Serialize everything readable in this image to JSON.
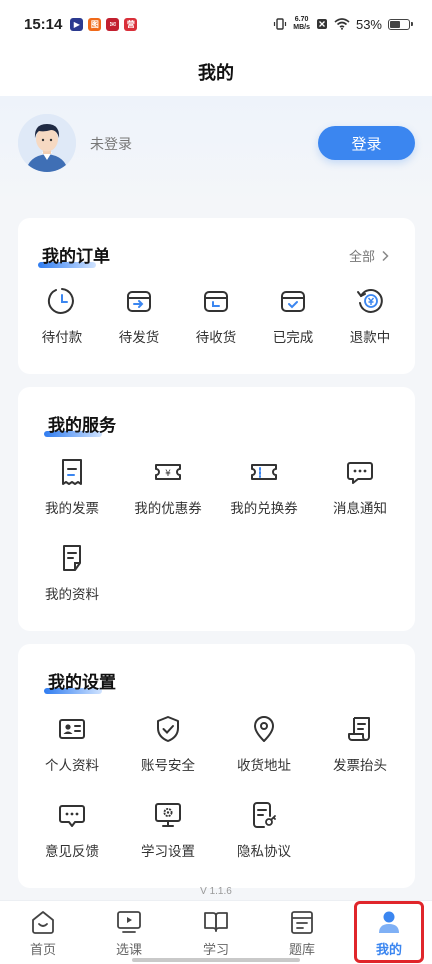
{
  "status": {
    "time": "15:14",
    "net_speed_value": "6.70",
    "net_speed_unit": "MB/s",
    "battery": "53%",
    "battery_level": 0.53
  },
  "page": {
    "title": "我的"
  },
  "profile": {
    "hint": "未登录",
    "login_label": "登录"
  },
  "orders": {
    "title": "我的订单",
    "more_label": "全部",
    "items": [
      {
        "label": "待付款",
        "icon": "clock-icon"
      },
      {
        "label": "待发货",
        "icon": "box-arrow-icon"
      },
      {
        "label": "待收货",
        "icon": "box-receive-icon"
      },
      {
        "label": "已完成",
        "icon": "box-check-icon"
      },
      {
        "label": "退款中",
        "icon": "refund-icon"
      }
    ]
  },
  "services": {
    "title": "我的服务",
    "items": [
      {
        "label": "我的发票",
        "icon": "invoice-icon"
      },
      {
        "label": "我的优惠券",
        "icon": "coupon-icon"
      },
      {
        "label": "我的兑换券",
        "icon": "voucher-icon"
      },
      {
        "label": "消息通知",
        "icon": "message-icon"
      },
      {
        "label": "我的资料",
        "icon": "document-icon"
      }
    ]
  },
  "settings": {
    "title": "我的设置",
    "items": [
      {
        "label": "个人资料",
        "icon": "id-card-icon"
      },
      {
        "label": "账号安全",
        "icon": "shield-icon"
      },
      {
        "label": "收货地址",
        "icon": "location-icon"
      },
      {
        "label": "发票抬头",
        "icon": "scroll-icon"
      },
      {
        "label": "意见反馈",
        "icon": "feedback-icon"
      },
      {
        "label": "学习设置",
        "icon": "monitor-gear-icon"
      },
      {
        "label": "隐私协议",
        "icon": "privacy-icon"
      }
    ]
  },
  "version": "V 1.1.6",
  "tabs": [
    {
      "label": "首页",
      "icon": "home-icon",
      "active": false
    },
    {
      "label": "选课",
      "icon": "play-screen-icon",
      "active": false
    },
    {
      "label": "学习",
      "icon": "book-icon",
      "active": false
    },
    {
      "label": "题库",
      "icon": "question-bank-icon",
      "active": false
    },
    {
      "label": "我的",
      "icon": "person-icon",
      "active": true
    }
  ],
  "colors": {
    "accent": "#3b86f0",
    "highlight": "#e0262b",
    "background": "#f4f6f9"
  }
}
